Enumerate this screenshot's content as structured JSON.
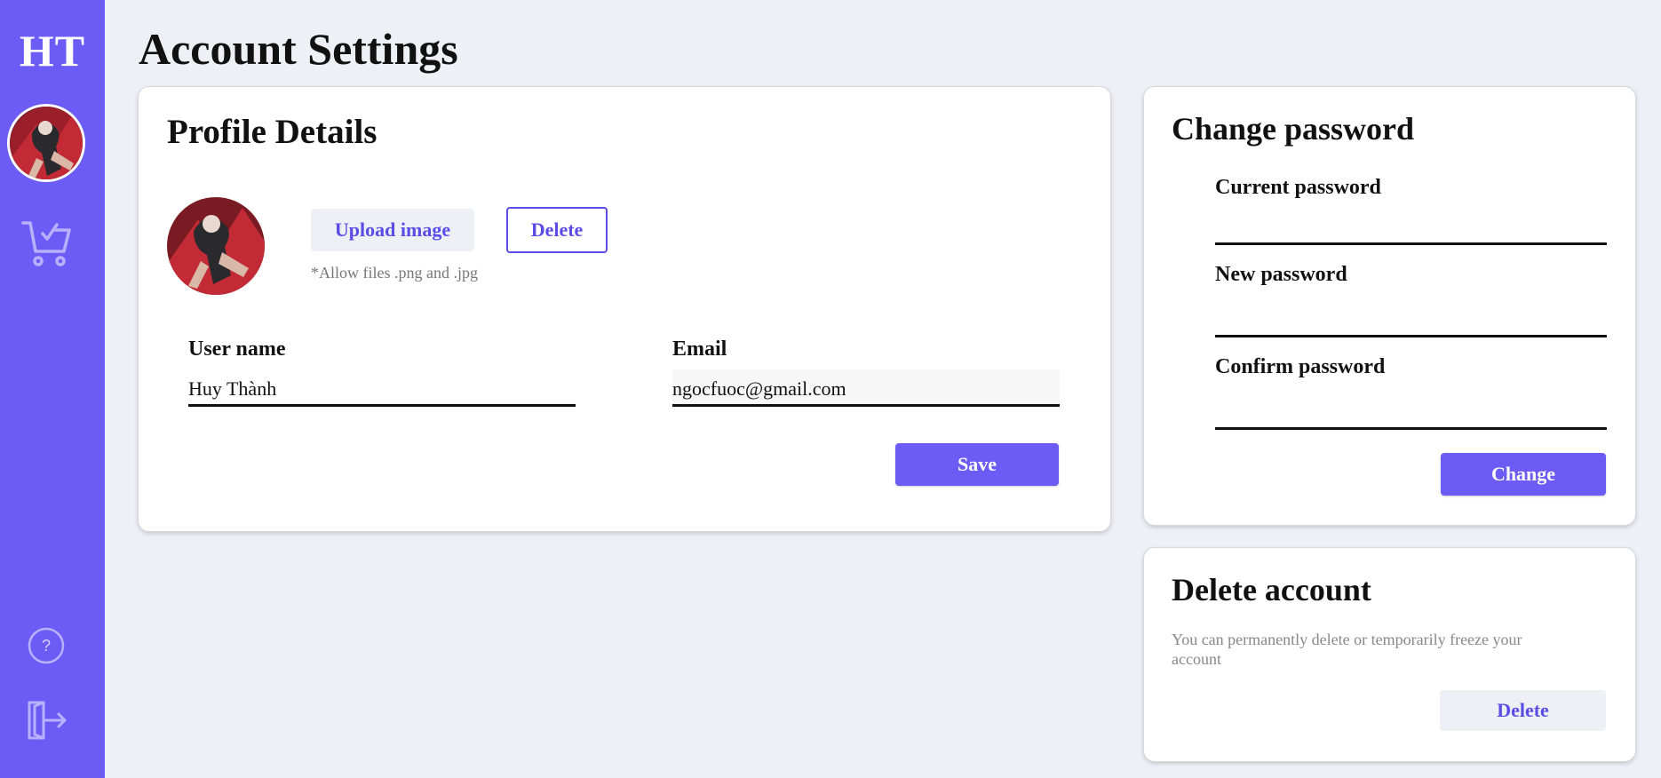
{
  "sidebar": {
    "logo": "HT",
    "icons": [
      "user-avatar",
      "cart-check-icon",
      "help-icon",
      "logout-icon"
    ],
    "accent": "#6c5cf5"
  },
  "page": {
    "title": "Account Settings"
  },
  "profile": {
    "heading": "Profile Details",
    "upload_label": "Upload image",
    "delete_label": "Delete",
    "hint": "*Allow files .png and .jpg",
    "username_label": "User name",
    "username_value": "Huy Thành",
    "email_label": "Email",
    "email_value": "ngocfuoc@gmail.com",
    "save_label": "Save"
  },
  "password": {
    "heading": "Change password",
    "current_label": "Current password",
    "new_label": "New password",
    "confirm_label": "Confirm password",
    "change_label": "Change"
  },
  "delete_account": {
    "heading": "Delete account",
    "description": "You can permanently delete or temporarily freeze your account",
    "delete_label": "Delete"
  }
}
